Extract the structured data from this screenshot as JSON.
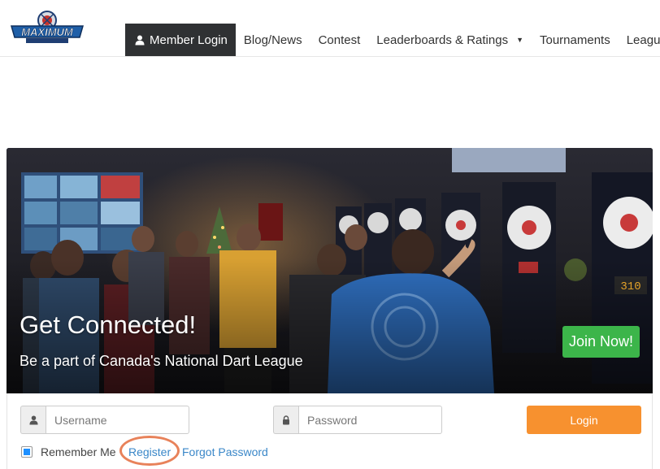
{
  "header": {
    "logo_icon": "maximum-darts-logo",
    "logo_text": "MAXIMUM",
    "nav": [
      {
        "label": "Member Login",
        "icon": "user-icon",
        "active": true
      },
      {
        "label": "Blog/News"
      },
      {
        "label": "Contest"
      },
      {
        "label": "Leaderboards & Ratings",
        "dropdown": true
      },
      {
        "label": "Tournaments"
      },
      {
        "label": "Leagues"
      }
    ]
  },
  "hero": {
    "title": "Get Connected!",
    "subtitle": "Be a part of Canada's National Dart League",
    "cta_label": "Join Now!",
    "cta_color": "#3cb54a"
  },
  "login": {
    "username_placeholder": "Username",
    "password_placeholder": "Password",
    "username_value": "",
    "password_value": "",
    "login_label": "Login",
    "login_color": "#f7912f",
    "remember_label": "Remember Me",
    "remember_checked": true,
    "register_label": "Register",
    "forgot_label": "Forgot Password",
    "link_color": "#3a87c8"
  }
}
